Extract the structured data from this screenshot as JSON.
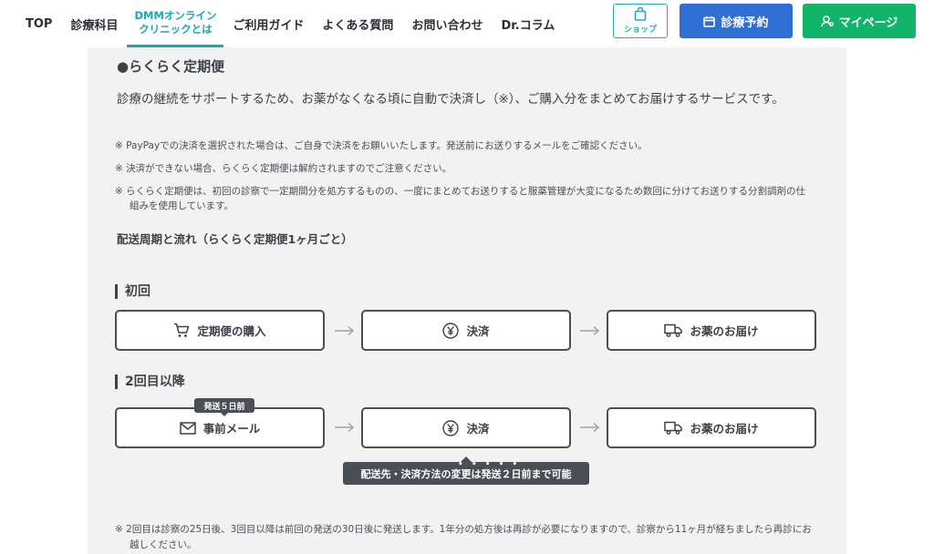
{
  "nav": {
    "items": [
      "TOP",
      "診療科目"
    ],
    "active": [
      "DMMオンライン",
      "クリニックとは"
    ],
    "rest": [
      "ご利用ガイド",
      "よくある質問",
      "お問い合わせ",
      "Dr.コラム"
    ]
  },
  "header_buttons": {
    "shop": "ショップ",
    "reserve": "診療予約",
    "mypage": "マイページ"
  },
  "colors": {
    "accent": "#18a6b8",
    "reserve": "#2f6fd4",
    "mypage": "#12b46a",
    "panel": "#f2f2f2"
  },
  "content": {
    "title": "●らくらく定期便",
    "lead": "診療の継続をサポートするため、お薬がなくなる頃に自動で決済し（※）、ご購入分をまとめてお届けするサービスです。",
    "notes": [
      "※ PayPayでの決済を選択された場合は、ご自身で決済をお願いいたします。発送前にお送りするメールをご確認ください。",
      "※ 決済ができない場合、らくらく定期便は解約されますのでご注意ください。",
      "※ らくらく定期便は、初回の診察で一定期間分を処方するものの、一度にまとめてお送りすると服薬管理が大変になるため数回に分けてお送りする分割調剤の仕組みを使用しています。"
    ],
    "flow_title": "配送周期と流れ（らくらく定期便1ヶ月ごと）",
    "first": {
      "title": "初回",
      "steps": [
        {
          "label": "定期便の購入",
          "icon": "cart-icon"
        },
        {
          "label": "決済",
          "icon": "yen-icon"
        },
        {
          "label": "お薬のお届け",
          "icon": "truck-icon"
        }
      ]
    },
    "second": {
      "title": "2回目以降",
      "badge": "発送５日前",
      "steps": [
        {
          "label": "事前メール",
          "icon": "mail-icon"
        },
        {
          "label": "決済",
          "icon": "yen-icon"
        },
        {
          "label": "お薬のお届け",
          "icon": "truck-icon"
        }
      ],
      "tooltip": "配送先・決済方法の変更は発送２日前まで可能",
      "emphasis_dots": "• • • • •"
    },
    "footnote": "※ 2回目は診察の25日後、3回目以降は前回の発送の30日後に発送します。1年分の処方後は再診が必要になりますので、診察から11ヶ月が経ちましたら再診にお越しください。"
  }
}
